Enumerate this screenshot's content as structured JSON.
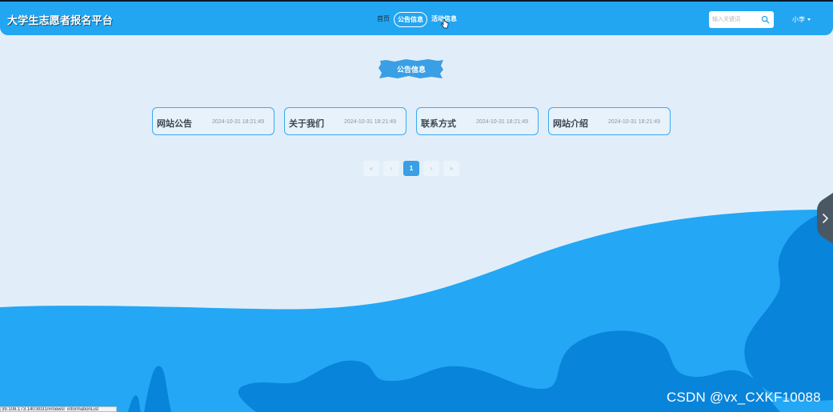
{
  "colors": {
    "background": "#e1eef9",
    "header": "#22a6f2",
    "wave_light": "#24a7f4",
    "wave_dark": "#0884da",
    "accent": "#3a9fe4",
    "card_border": "#3aa9f1"
  },
  "header": {
    "brand": "大学生志愿者报名平台",
    "nav": [
      {
        "label": "首页"
      },
      {
        "label": "公告信息"
      },
      {
        "label": "活动信息"
      }
    ],
    "search": {
      "placeholder": "输入关键词",
      "icon": "search-icon"
    },
    "user": {
      "name": "小李",
      "icon": "chevron-down-icon"
    }
  },
  "section": {
    "title": "公告信息"
  },
  "cards": [
    {
      "title": "网站公告",
      "date": "2024-10-31 18:21:49"
    },
    {
      "title": "关于我们",
      "date": "2024-10-31 18:21:49"
    },
    {
      "title": "联系方式",
      "date": "2024-10-31 18:21:49"
    },
    {
      "title": "网站介绍",
      "date": "2024-10-31 18:21:49"
    }
  ],
  "pagination": {
    "first": "«",
    "prev": "‹",
    "current": "1",
    "next": "›",
    "last": "»"
  },
  "side_tab": {
    "icon": "chevron-right-icon"
  },
  "watermark": "CSDN @vx_CXKF10088",
  "status_url": "39.108.173.140:8031/#/newsl_informationList"
}
